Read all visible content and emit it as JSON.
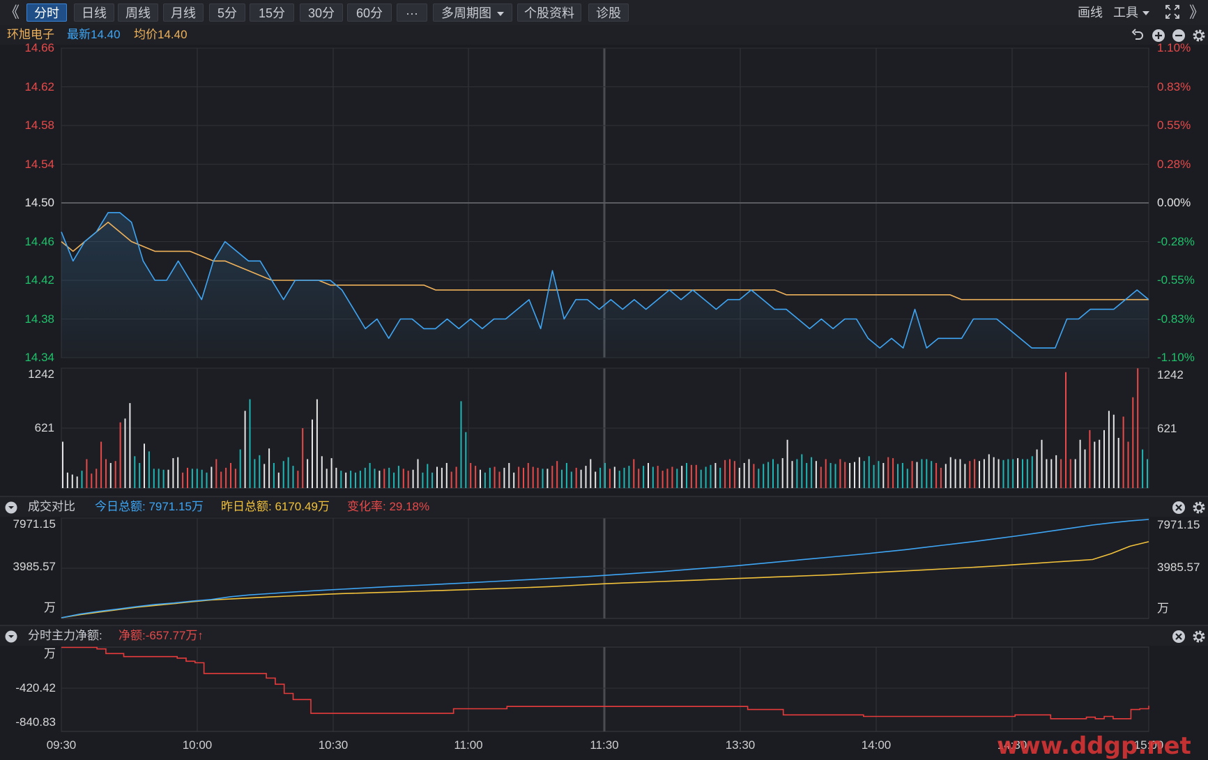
{
  "toolbar": {
    "collapse_icon": "《",
    "expand_icon": "》",
    "tabs": [
      {
        "label": "分时",
        "active": true
      },
      {
        "label": "日线"
      },
      {
        "label": "周线"
      },
      {
        "label": "月线"
      },
      {
        "label": "5分"
      },
      {
        "label": "15分"
      },
      {
        "label": "30分"
      },
      {
        "label": "60分"
      },
      {
        "label": "···"
      },
      {
        "label": "多周期图"
      },
      {
        "label": "个股资料"
      },
      {
        "label": "诊股"
      }
    ],
    "draw_label": "画线",
    "tools_label": "工具",
    "fullscreen_icon": "fullscreen-icon"
  },
  "quote": {
    "stock_name": "环旭电子",
    "latest_label": "最新",
    "latest_value": "14.40",
    "avg_label": "均价",
    "avg_value": "14.40"
  },
  "colors": {
    "up": "#e84a4a",
    "down": "#1fc26b",
    "price_line": "#3ea6f5",
    "avg_line": "#f0b25a",
    "today": "#3ea6f5",
    "yesterday": "#f2c23b",
    "net": "#e83b3b",
    "neutral": "#e6e6e6"
  },
  "price_axis": {
    "left": [
      "14.66",
      "14.62",
      "14.58",
      "14.54",
      "14.50",
      "14.46",
      "14.42",
      "14.38",
      "14.34"
    ],
    "right": [
      "1.10%",
      "0.83%",
      "0.55%",
      "0.28%",
      "0.00%",
      "-0.28%",
      "-0.55%",
      "-0.83%",
      "-1.10%"
    ]
  },
  "volume_axis": {
    "labels": [
      "1242",
      "621"
    ]
  },
  "compare_panel": {
    "title": "成交对比",
    "today_label": "今日总额: 7971.15万",
    "yesterday_label": "昨日总额: 6170.49万",
    "change_label": "变化率: 29.18%",
    "axis": [
      "7971.15",
      "3985.57",
      "万"
    ]
  },
  "net_panel": {
    "title": "分时主力净额:",
    "value_label": "净额:-657.77万",
    "arrow": "↑",
    "axis": [
      "万",
      "-420.42",
      "-840.83"
    ]
  },
  "time_axis": [
    "09:30",
    "10:00",
    "10:30",
    "11:00",
    "11:30",
    "13:30",
    "14:00",
    "14:30",
    "15:00"
  ],
  "watermark": "www.ddgp.net",
  "chart_data": [
    {
      "type": "line",
      "title": "",
      "prev_close": 14.5,
      "ylim": [
        14.34,
        14.66
      ],
      "x_minutes": [
        0,
        2,
        4,
        6,
        8,
        10,
        12,
        14,
        16,
        18,
        20,
        22,
        24,
        26,
        28,
        30,
        32,
        34,
        36,
        38,
        40,
        42,
        44,
        46,
        48,
        50,
        52,
        54,
        56,
        58,
        60,
        62,
        64,
        66,
        68,
        70,
        72,
        74,
        76,
        78,
        80,
        82,
        84,
        86,
        88,
        90,
        92,
        94,
        96,
        98,
        100,
        102,
        104,
        106,
        108,
        110,
        112,
        114,
        116,
        118,
        120,
        122,
        124,
        126,
        128,
        130,
        132,
        134,
        136,
        138,
        140,
        142,
        144,
        146,
        148,
        150,
        152,
        154,
        156,
        158,
        160,
        162,
        164,
        166,
        168,
        170,
        172,
        174,
        176,
        178,
        180,
        182,
        184,
        186,
        188,
        190,
        192,
        194,
        196,
        198,
        200,
        202,
        204,
        206,
        208,
        210,
        212,
        214,
        216,
        218,
        220,
        222,
        224,
        226,
        228,
        230,
        232,
        234,
        236,
        238,
        240
      ],
      "series": [
        {
          "name": "最新",
          "values": [
            14.47,
            14.44,
            14.46,
            14.47,
            14.49,
            14.49,
            14.48,
            14.44,
            14.42,
            14.42,
            14.44,
            14.42,
            14.4,
            14.44,
            14.46,
            14.45,
            14.44,
            14.44,
            14.42,
            14.4,
            14.42,
            14.42,
            14.42,
            14.42,
            14.41,
            14.39,
            14.37,
            14.38,
            14.36,
            14.38,
            14.38,
            14.37,
            14.37,
            14.38,
            14.37,
            14.38,
            14.37,
            14.38,
            14.38,
            14.39,
            14.4,
            14.37,
            14.43,
            14.38,
            14.4,
            14.4,
            14.39,
            14.4,
            14.39,
            14.4,
            14.39,
            14.4,
            14.41,
            14.4,
            14.41,
            14.4,
            14.39,
            14.4,
            14.4,
            14.41,
            14.4,
            14.39,
            14.39,
            14.38,
            14.37,
            14.38,
            14.37,
            14.38,
            14.38,
            14.36,
            14.35,
            14.36,
            14.35,
            14.39,
            14.35,
            14.36,
            14.36,
            14.36,
            14.38,
            14.38,
            14.38,
            14.37,
            14.36,
            14.35,
            14.35,
            14.35,
            14.38,
            14.38,
            14.39,
            14.39,
            14.39,
            14.4,
            14.41,
            14.4
          ]
        },
        {
          "name": "均价",
          "values": [
            14.46,
            14.45,
            14.46,
            14.47,
            14.48,
            14.47,
            14.46,
            14.455,
            14.45,
            14.45,
            14.45,
            14.45,
            14.445,
            14.44,
            14.44,
            14.435,
            14.43,
            14.425,
            14.42,
            14.42,
            14.42,
            14.42,
            14.42,
            14.415,
            14.415,
            14.415,
            14.415,
            14.415,
            14.415,
            14.415,
            14.415,
            14.415,
            14.41,
            14.41,
            14.41,
            14.41,
            14.41,
            14.41,
            14.41,
            14.41,
            14.41,
            14.41,
            14.41,
            14.41,
            14.41,
            14.41,
            14.41,
            14.41,
            14.41,
            14.41,
            14.41,
            14.41,
            14.41,
            14.41,
            14.41,
            14.41,
            14.41,
            14.41,
            14.41,
            14.41,
            14.41,
            14.41,
            14.405,
            14.405,
            14.405,
            14.405,
            14.405,
            14.405,
            14.405,
            14.405,
            14.405,
            14.405,
            14.405,
            14.405,
            14.405,
            14.405,
            14.405,
            14.4,
            14.4,
            14.4,
            14.4,
            14.4,
            14.4,
            14.4,
            14.4,
            14.4,
            14.4,
            14.4,
            14.4,
            14.4,
            14.4,
            14.4,
            14.4,
            14.4
          ]
        }
      ]
    },
    {
      "type": "bar",
      "title": "",
      "ylim": [
        0,
        1242
      ],
      "series": [
        {
          "name": "成交量",
          "values": [
            480,
            160,
            140,
            120,
            180,
            300,
            150,
            200,
            480,
            300,
            260,
            280,
            680,
            720,
            880,
            330,
            260,
            460,
            380,
            200,
            200,
            190,
            190,
            310,
            320,
            160,
            210,
            200,
            200,
            190,
            160,
            220,
            300,
            170,
            210,
            260,
            200,
            400,
            800,
            920,
            300,
            340,
            250,
            410,
            260,
            160,
            280,
            320,
            230,
            180,
            620,
            300,
            710,
            920,
            330,
            200,
            310,
            210,
            180,
            160,
            180,
            160,
            180,
            210,
            260,
            200,
            180,
            200,
            210,
            160,
            230,
            200,
            180,
            190,
            300,
            160,
            250,
            160,
            220,
            210,
            260,
            170,
            220,
            900,
            580,
            260,
            230,
            190,
            160,
            210,
            220,
            170,
            210,
            260,
            160,
            220,
            210,
            260,
            220,
            210,
            200,
            200,
            230,
            280,
            190,
            260,
            170,
            210,
            190,
            230,
            300,
            170,
            210,
            260,
            200,
            220,
            180,
            210,
            230,
            300,
            200,
            230,
            260,
            220,
            230,
            180,
            200,
            220,
            200,
            230,
            260,
            240,
            240,
            190,
            220,
            240,
            260,
            210,
            290,
            300,
            280,
            210,
            260,
            300,
            250,
            200,
            250,
            270,
            300,
            250,
            310,
            500,
            280,
            300,
            350,
            260,
            320,
            280,
            220,
            300,
            260,
            250,
            300,
            270,
            260,
            270,
            320,
            280,
            330,
            240,
            280,
            260,
            320,
            310,
            250,
            260,
            200,
            280,
            270,
            300,
            300,
            280,
            260,
            210,
            250,
            320,
            300,
            300,
            250,
            280,
            300,
            280,
            300,
            350,
            320,
            300,
            290,
            300,
            300,
            310,
            300,
            300,
            330,
            400,
            500,
            300,
            300,
            340,
            300,
            1200,
            300,
            300,
            500,
            400,
            600,
            480,
            500,
            600,
            800,
            760,
            520,
            740,
            480,
            940,
            1240,
            400,
            300
          ]
        }
      ]
    },
    {
      "type": "line",
      "title": "",
      "ylim": [
        0,
        7971.15
      ],
      "series": [
        {
          "name": "今日",
          "values": [
            0,
            300,
            520,
            700,
            900,
            1080,
            1200,
            1350,
            1480,
            1700,
            1850,
            1950,
            2050,
            2150,
            2240,
            2320,
            2400,
            2480,
            2560,
            2630,
            2700,
            2780,
            2860,
            2940,
            3020,
            3100,
            3180,
            3260,
            3340,
            3440,
            3540,
            3640,
            3740,
            3860,
            3980,
            4100,
            4220,
            4360,
            4500,
            4640,
            4780,
            4920,
            5060,
            5200,
            5360,
            5520,
            5700,
            5880,
            6060,
            6240,
            6440,
            6640,
            6860,
            7080,
            7300,
            7520,
            7700,
            7850,
            7971.15
          ]
        },
        {
          "name": "昨日",
          "values": [
            0,
            250,
            450,
            650,
            850,
            1000,
            1150,
            1300,
            1440,
            1520,
            1600,
            1680,
            1750,
            1820,
            1900,
            1960,
            2000,
            2050,
            2100,
            2150,
            2200,
            2250,
            2300,
            2350,
            2400,
            2460,
            2520,
            2600,
            2680,
            2760,
            2820,
            2880,
            2940,
            3000,
            3060,
            3120,
            3180,
            3240,
            3300,
            3360,
            3420,
            3480,
            3560,
            3640,
            3720,
            3800,
            3880,
            3960,
            4040,
            4120,
            4220,
            4320,
            4420,
            4520,
            4620,
            4720,
            5200,
            5800,
            6170.49
          ]
        }
      ]
    },
    {
      "type": "line",
      "title": "",
      "ylim": [
        -1050,
        50
      ],
      "series": [
        {
          "name": "净额",
          "values": [
            0,
            0,
            0,
            0,
            -20,
            -80,
            -80,
            -120,
            -120,
            -120,
            -120,
            -120,
            -120,
            -140,
            -180,
            -200,
            -340,
            -340,
            -340,
            -340,
            -340,
            -340,
            -340,
            -400,
            -480,
            -600,
            -680,
            -680,
            -860,
            -860,
            -860,
            -860,
            -860,
            -860,
            -860,
            -860,
            -860,
            -860,
            -860,
            -860,
            -860,
            -860,
            -860,
            -860,
            -800,
            -800,
            -800,
            -800,
            -800,
            -800,
            -770,
            -770,
            -770,
            -770,
            -770,
            -770,
            -770,
            -770,
            -770,
            -770,
            -770,
            -770,
            -770,
            -770,
            -770,
            -770,
            -770,
            -770,
            -770,
            -770,
            -770,
            -770,
            -770,
            -770,
            -770,
            -770,
            -770,
            -810,
            -810,
            -810,
            -810,
            -880,
            -880,
            -880,
            -880,
            -880,
            -880,
            -880,
            -880,
            -880,
            -900,
            -900,
            -900,
            -900,
            -900,
            -900,
            -900,
            -900,
            -900,
            -900,
            -900,
            -900,
            -900,
            -900,
            -900,
            -900,
            -900,
            -880,
            -880,
            -880,
            -880,
            -930,
            -930,
            -930,
            -930,
            -910,
            -930,
            -900,
            -930,
            -930,
            -810,
            -800,
            -760
          ]
        }
      ]
    }
  ]
}
